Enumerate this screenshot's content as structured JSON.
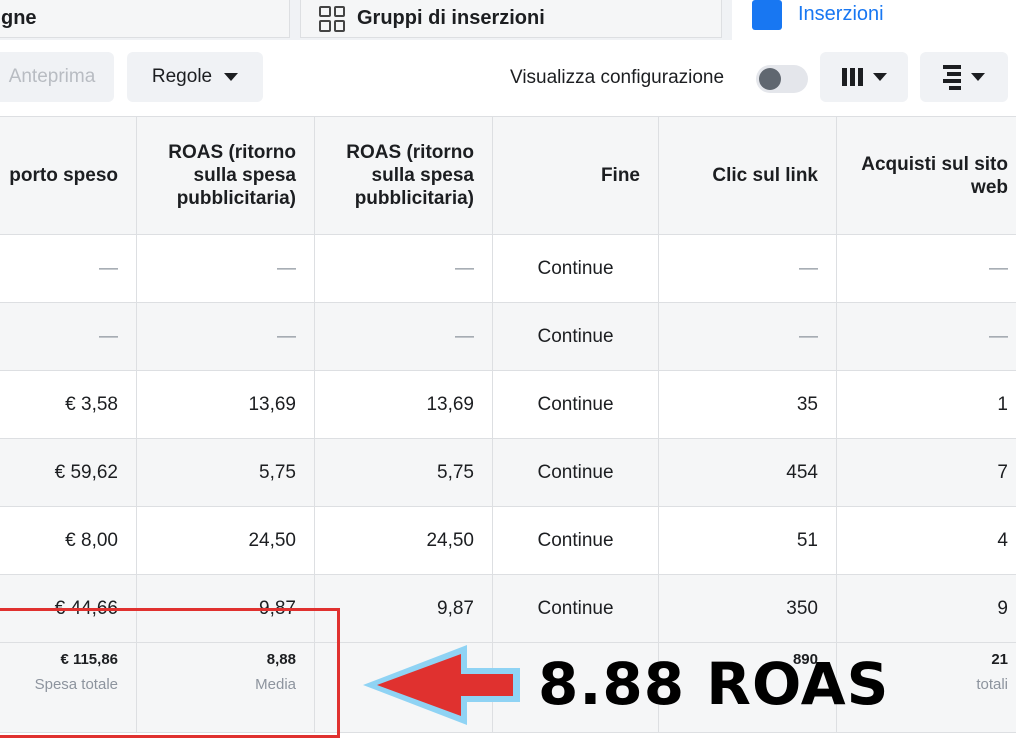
{
  "tabs": {
    "campaigns": "gne",
    "adsets": "Gruppi di inserzioni",
    "ads": "Inserzioni"
  },
  "toolbar": {
    "preview": "Anteprima",
    "rules": "Regole",
    "view_config": "Visualizza configurazione"
  },
  "table": {
    "headers": {
      "amount_spent": "porto speso",
      "roas1": "ROAS (ritorno sulla spesa pubblicitaria)",
      "roas2": "ROAS (ritorno sulla spesa pubblicitaria)",
      "end": "Fine",
      "link_clicks": "Clic sul link",
      "purchases": "Acquisti sul sito web"
    },
    "rows": [
      {
        "spent": "—",
        "roas1": "—",
        "roas2": "—",
        "end": "Continue",
        "clicks": "—",
        "purchases": "—"
      },
      {
        "spent": "—",
        "roas1": "—",
        "roas2": "—",
        "end": "Continue",
        "clicks": "—",
        "purchases": "—"
      },
      {
        "spent": "€ 3,58",
        "roas1": "13,69",
        "roas2": "13,69",
        "end": "Continue",
        "clicks": "35",
        "purchases": "1"
      },
      {
        "spent": "€ 59,62",
        "roas1": "5,75",
        "roas2": "5,75",
        "end": "Continue",
        "clicks": "454",
        "purchases": "7"
      },
      {
        "spent": "€ 8,00",
        "roas1": "24,50",
        "roas2": "24,50",
        "end": "Continue",
        "clicks": "51",
        "purchases": "4"
      },
      {
        "spent": "€ 44,66",
        "roas1": "9,87",
        "roas2": "9,87",
        "end": "Continue",
        "clicks": "350",
        "purchases": "9"
      }
    ],
    "totals": {
      "spent_value": "€ 115,86",
      "spent_label": "Spesa totale",
      "roas1_value": "8,88",
      "roas1_label": "Media",
      "clicks_value": "890",
      "purchases_value": "21",
      "purchases_label": "totali"
    }
  },
  "annotation": {
    "text": "8.88 ROAS",
    "box_color": "#e0312f",
    "arrow_color": "#e0312f",
    "arrow_outline_color": "#8fd3f4"
  }
}
